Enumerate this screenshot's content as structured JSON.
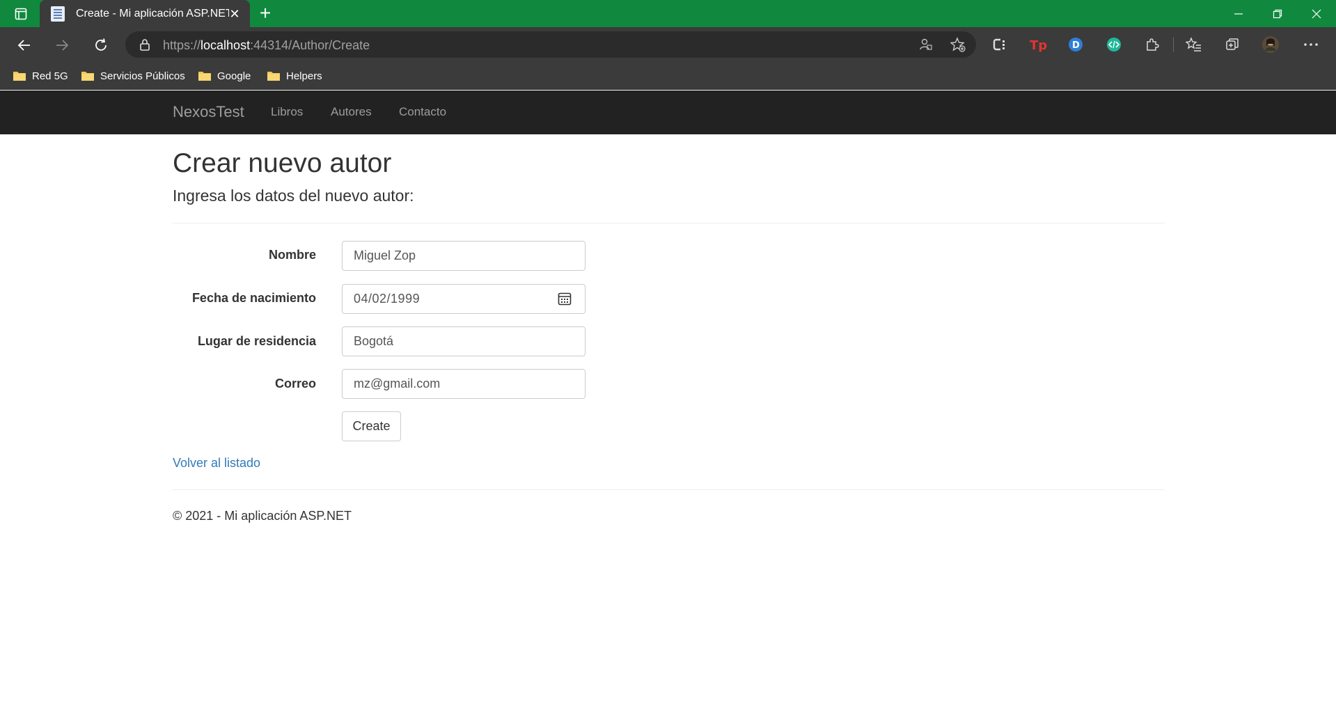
{
  "browser": {
    "tab_title": "Create - Mi aplicación ASP.NET",
    "url_scheme": "https://",
    "url_host": "localhost",
    "url_rest": ":44314/Author/Create",
    "bookmarks": [
      "Red 5G",
      "Servicios Públicos",
      "Google",
      "Helpers"
    ],
    "extensions": [
      "collections-icon",
      "tp-extension-icon",
      "d-extension-icon",
      "code-extension-icon"
    ]
  },
  "navbar": {
    "brand": "NexosTest",
    "links": [
      "Libros",
      "Autores",
      "Contacto"
    ]
  },
  "page": {
    "title": "Crear nuevo autor",
    "subtitle": "Ingresa los datos del nuevo autor:"
  },
  "form": {
    "nombre_label": "Nombre",
    "nombre_value": "Miguel Zop",
    "fecha_label": "Fecha de nacimiento",
    "fecha_value": "04/02/1999",
    "lugar_label": "Lugar de residencia",
    "lugar_value": "Bogotá",
    "correo_label": "Correo",
    "correo_value": "mz@gmail.com",
    "submit_label": "Create"
  },
  "back_link": "Volver al listado",
  "footer": "© 2021 - Mi aplicación ASP.NET",
  "colors": {
    "titlebar": "#10893e",
    "navbar": "#222222",
    "link": "#337ab7"
  }
}
